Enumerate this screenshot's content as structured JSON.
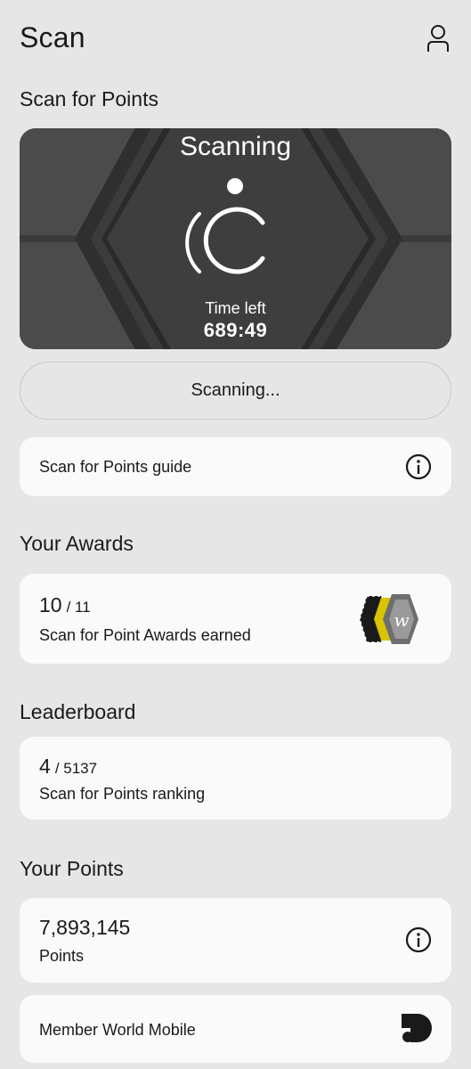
{
  "header": {
    "title": "Scan",
    "profile_icon": "user-icon"
  },
  "scan_section": {
    "title": "Scan for Points",
    "status": "Scanning",
    "time_left_label": "Time left",
    "time_left_value": "689:49",
    "button_label": "Scanning..."
  },
  "guide": {
    "label": "Scan for Points guide",
    "icon": "info-icon"
  },
  "awards": {
    "title": "Your Awards",
    "earned": "10",
    "total": "/ 11",
    "label": "Scan for Point Awards earned",
    "badge_icon": "award-badges-icon"
  },
  "leaderboard": {
    "title": "Leaderboard",
    "rank": "4",
    "total": "/ 5137",
    "label": "Scan for Points ranking"
  },
  "points": {
    "title": "Your Points",
    "value": "7,893,145",
    "label": "Points",
    "icon": "info-icon"
  },
  "member": {
    "label": "Member World Mobile",
    "icon": "world-mobile-logo-icon"
  },
  "colors": {
    "background": "#e6e6e6",
    "card": "#fafafa",
    "scan_card": "#4a4a4a",
    "text": "#1a1a1a"
  }
}
